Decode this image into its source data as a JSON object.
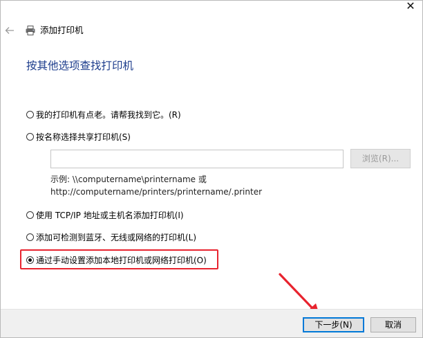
{
  "window": {
    "title": "添加打印机",
    "close_glyph": "✕"
  },
  "page_title": "按其他选项查找打印机",
  "options": [
    {
      "label": "我的打印机有点老。请帮我找到它。(R)",
      "checked": false
    },
    {
      "label": "按名称选择共享打印机(S)",
      "checked": false
    },
    {
      "label": "使用 TCP/IP 地址或主机名添加打印机(I)",
      "checked": false
    },
    {
      "label": "添加可检测到蓝牙、无线或网络的打印机(L)",
      "checked": false
    },
    {
      "label": "通过手动设置添加本地打印机或网络打印机(O)",
      "checked": true
    }
  ],
  "share_input": {
    "value": "",
    "placeholder": ""
  },
  "browse_label": "浏览(R)...",
  "example": {
    "line1": "示例: \\\\computername\\printername 或",
    "line2": "http://computername/printers/printername/.printer"
  },
  "buttons": {
    "next": "下一步(N)",
    "cancel": "取消"
  },
  "colors": {
    "title_blue": "#1c3c8c",
    "highlight_red": "#e8232e",
    "focus_blue": "#0078d7"
  },
  "icons": [
    "back-arrow-icon",
    "printer-icon",
    "close-icon"
  ]
}
